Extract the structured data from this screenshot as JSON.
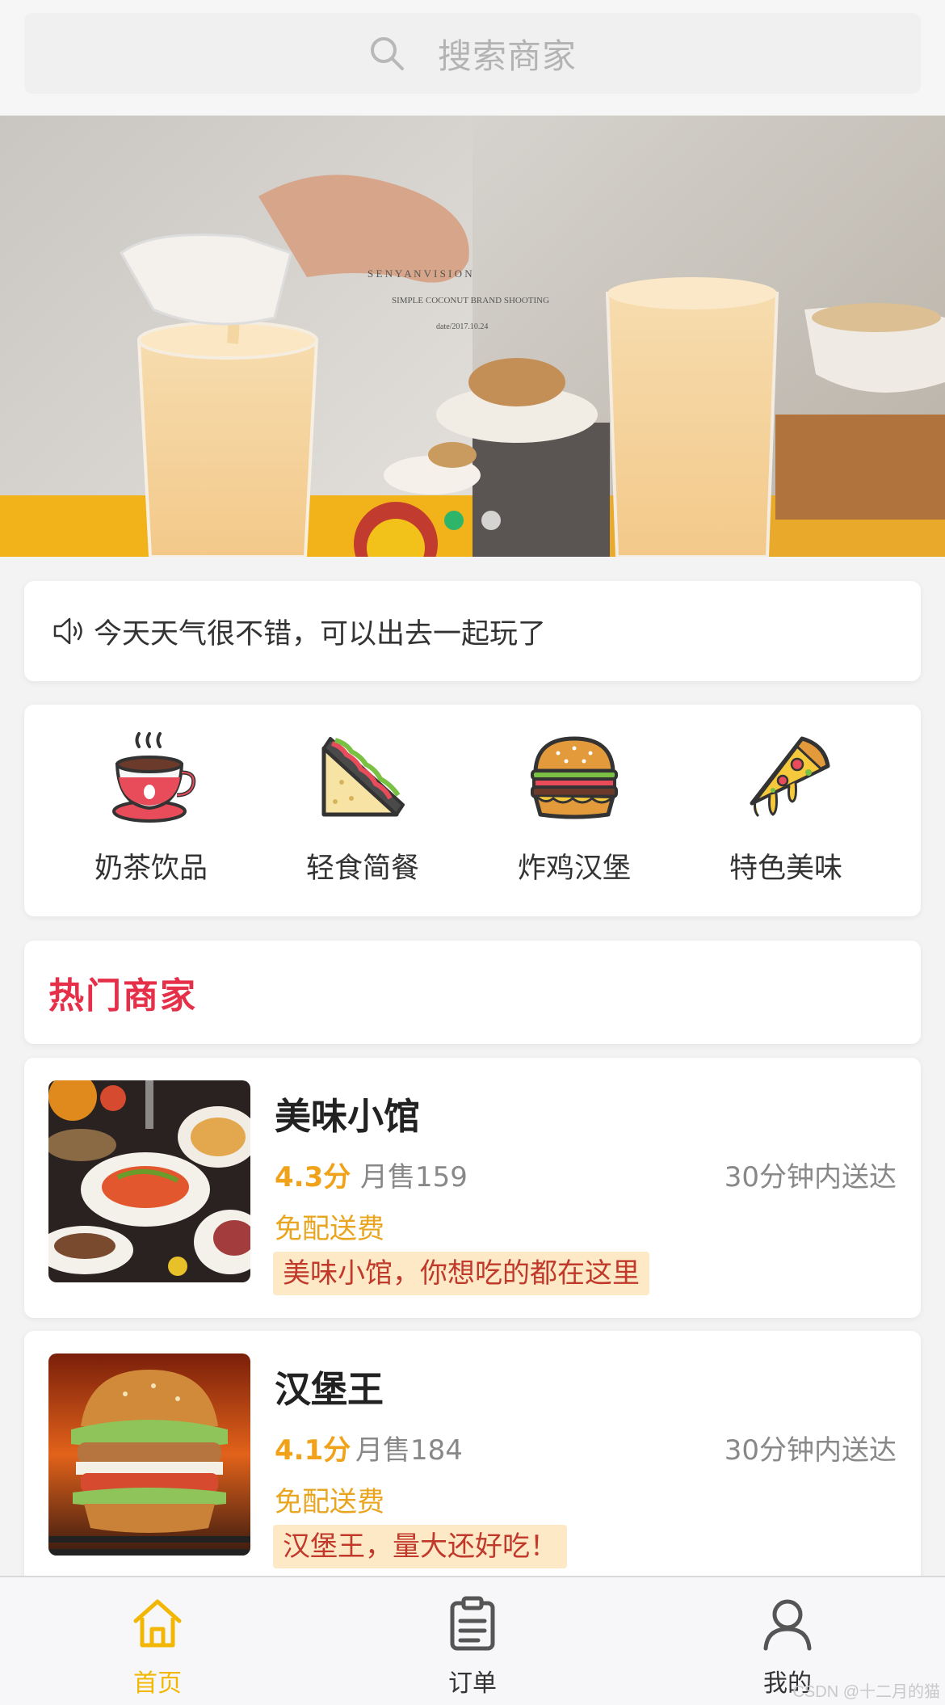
{
  "search": {
    "placeholder": "搜索商家"
  },
  "banner": {
    "photo_text": {
      "brand": "S E N Y A N   V I S I O N",
      "subtitle": "SIMPLE COCONUT BRAND SHOOTING",
      "date": "date/2017.10.24"
    },
    "active_slide": 1,
    "slide_count": 2,
    "dot_colors": {
      "active": "#2fb56a",
      "inactive": "#ffffff"
    }
  },
  "notice": {
    "icon": "speaker-icon",
    "text": "今天天气很不错，可以出去一起玩了"
  },
  "categories": [
    {
      "icon": "milk-tea-icon",
      "label": "奶茶饮品"
    },
    {
      "icon": "sandwich-icon",
      "label": "轻食简餐"
    },
    {
      "icon": "burger-icon",
      "label": "炸鸡汉堡"
    },
    {
      "icon": "pizza-icon",
      "label": "特色美味"
    }
  ],
  "hot": {
    "title": "热门商家",
    "color": "#e6304a"
  },
  "shops": [
    {
      "name": "美味小馆",
      "rating": "4.3分",
      "sales": "月售159",
      "delivery_time": "30分钟内送达",
      "delivery_fee": "免配送费",
      "slogan": "美味小馆，你想吃的都在这里"
    },
    {
      "name": "汉堡王",
      "rating": "4.1分",
      "sales": "月售184",
      "delivery_time": "30分钟内送达",
      "delivery_fee": "免配送费",
      "slogan": "汉堡王，量大还好吃！"
    }
  ],
  "tabbar": {
    "items": [
      {
        "icon": "home-icon",
        "label": "首页",
        "active": true
      },
      {
        "icon": "orders-icon",
        "label": "订单",
        "active": false
      },
      {
        "icon": "user-icon",
        "label": "我的",
        "active": false
      }
    ],
    "active_color": "#f2b705"
  },
  "watermark": "CSDN @十二月的猫"
}
